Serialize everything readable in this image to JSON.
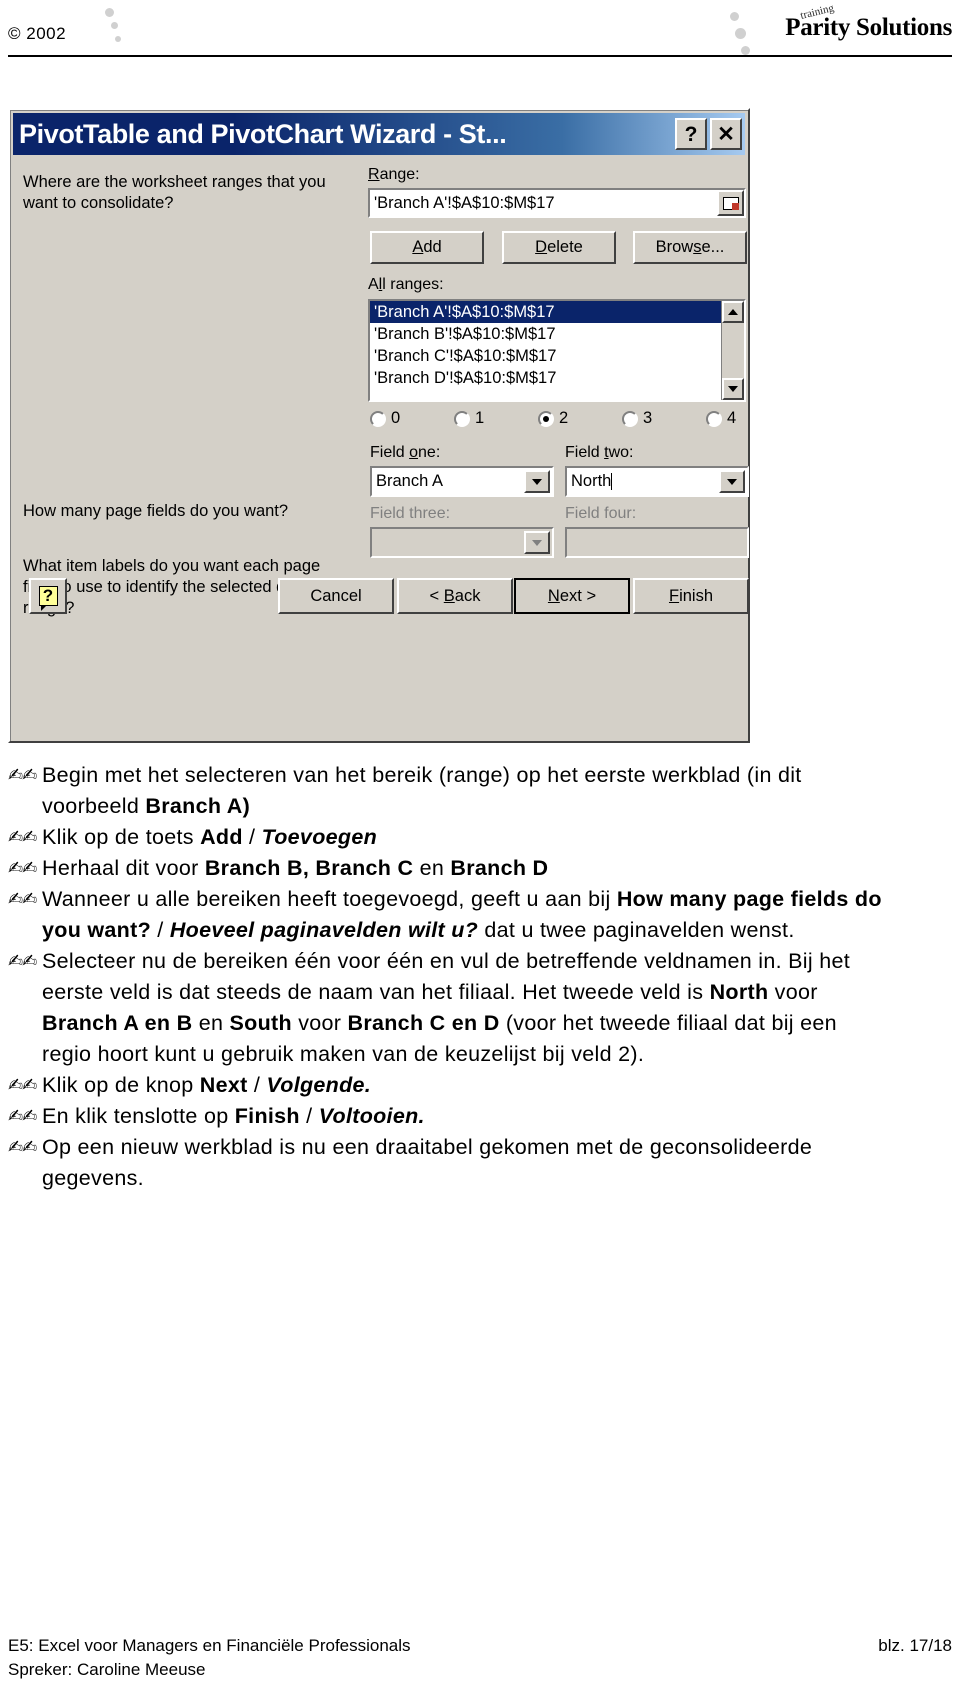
{
  "header": {
    "copyright": "© 2002",
    "logo_main": "Parity Solutions",
    "logo_sub": "training"
  },
  "dialog": {
    "title": "PivotTable and PivotChart Wizard - St...",
    "help_button": "?",
    "close_button": "✕",
    "prompt_1": "Where are the worksheet ranges that you want to consolidate?",
    "prompt_2": "How many page fields do you want?",
    "prompt_3": "What item labels do you want each page field to use to identify the selected data range?",
    "range_label": "Range:",
    "range_value": "'Branch A'!$A$10:$M$17",
    "buttons": {
      "add": "Add",
      "delete": "Delete",
      "browse": "Browse...",
      "cancel": "Cancel",
      "back": "< Back",
      "next": "Next >",
      "finish": "Finish",
      "help": "?"
    },
    "all_ranges_label": "All ranges:",
    "all_ranges": [
      {
        "text": "'Branch A'!$A$10:$M$17",
        "selected": true
      },
      {
        "text": "'Branch B'!$A$10:$M$17",
        "selected": false
      },
      {
        "text": "'Branch C'!$A$10:$M$17",
        "selected": false
      },
      {
        "text": "'Branch D'!$A$10:$M$17",
        "selected": false
      }
    ],
    "page_field_options": [
      {
        "label": "0",
        "checked": false
      },
      {
        "label": "1",
        "checked": false
      },
      {
        "label": "2",
        "checked": true
      },
      {
        "label": "3",
        "checked": false
      },
      {
        "label": "4",
        "checked": false
      }
    ],
    "fields": {
      "one_label": "Field one:",
      "one_value": "Branch A",
      "two_label": "Field two:",
      "two_value": "North",
      "three_label": "Field three:",
      "three_value": "",
      "four_label": "Field four:",
      "four_value": ""
    },
    "colors": {
      "face": "#d4d0c8",
      "title_start": "#0a246a",
      "title_end": "#a6caf0",
      "selection": "#0a246a"
    }
  },
  "instructions": {
    "bullet_glyph": "✍✍",
    "items": [
      [
        {
          "t": "Begin met het selecteren van het bereik (range) op het eerste werkblad (in dit voorbeeld ",
          "s": "n"
        },
        {
          "t": "Branch A)",
          "s": "b"
        }
      ],
      [
        {
          "t": "Klik op de toets ",
          "s": "n"
        },
        {
          "t": "Add",
          "s": "b"
        },
        {
          "t": " / ",
          "s": "n"
        },
        {
          "t": "Toevoegen",
          "s": "i"
        }
      ],
      [
        {
          "t": "Herhaal dit voor ",
          "s": "n"
        },
        {
          "t": "Branch B, Branch C",
          "s": "b"
        },
        {
          "t": " en ",
          "s": "n"
        },
        {
          "t": "Branch D",
          "s": "b"
        }
      ],
      [
        {
          "t": "Wanneer u alle bereiken heeft toegevoegd, geeft u aan bij ",
          "s": "n"
        },
        {
          "t": "How many page fields do you want?",
          "s": "b"
        },
        {
          "t": " / ",
          "s": "n"
        },
        {
          "t": "Hoeveel paginavelden wilt u?",
          "s": "i"
        },
        {
          "t": " dat u twee paginavelden wenst.",
          "s": "n"
        }
      ],
      [
        {
          "t": "Selecteer nu de bereiken één voor één en vul de betreffende veldnamen in. Bij het eerste veld is dat steeds de naam van het filiaal. Het tweede veld is ",
          "s": "n"
        },
        {
          "t": "North",
          "s": "b"
        },
        {
          "t": " voor ",
          "s": "n"
        },
        {
          "t": "Branch A en B",
          "s": "b"
        },
        {
          "t": " en ",
          "s": "n"
        },
        {
          "t": "South",
          "s": "b"
        },
        {
          "t": " voor ",
          "s": "n"
        },
        {
          "t": "Branch C en D",
          "s": "b"
        },
        {
          "t": " (voor het tweede filiaal dat bij een regio hoort kunt u gebruik maken van de keuzelijst bij veld 2).",
          "s": "n"
        }
      ],
      [
        {
          "t": "Klik op de knop ",
          "s": "n"
        },
        {
          "t": "Next",
          "s": "b"
        },
        {
          "t": " / ",
          "s": "n"
        },
        {
          "t": "Volgende.",
          "s": "i"
        }
      ],
      [
        {
          "t": "En klik tenslotte op ",
          "s": "n"
        },
        {
          "t": "Finish",
          "s": "b"
        },
        {
          "t": " / ",
          "s": "n"
        },
        {
          "t": "Voltooien.",
          "s": "i"
        }
      ],
      [
        {
          "t": "Op een nieuw werkblad is nu een draaitabel gekomen met de geconsolideerde gegevens.",
          "s": "n"
        }
      ]
    ]
  },
  "footer": {
    "line1_left": "E5: Excel voor Managers en Financiële Professionals",
    "line1_right": "blz. 17/18",
    "line2_left": "Spreker: Caroline Meeuse"
  }
}
